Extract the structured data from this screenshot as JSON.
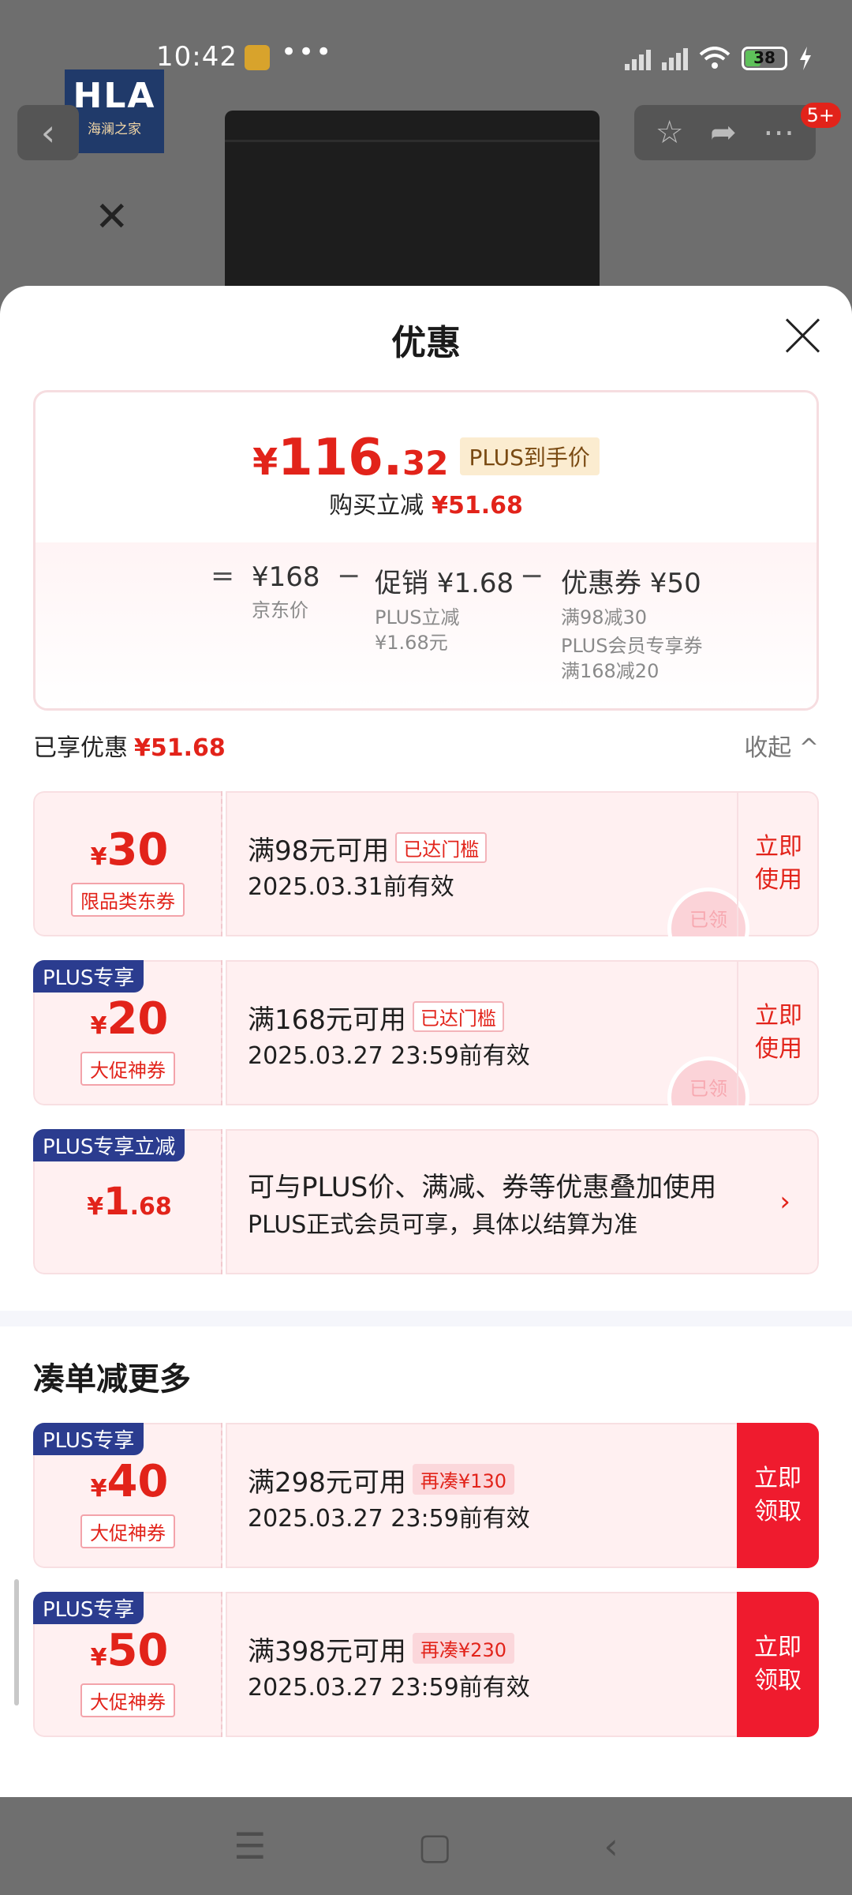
{
  "status_bar": {
    "time": "10:42",
    "dots": "•••",
    "battery": "38"
  },
  "background": {
    "logo_text": "HLA",
    "logo_sub": "海澜之家",
    "badge": "5+"
  },
  "sheet": {
    "title": "优惠",
    "final_price": {
      "yen": "¥",
      "int": "116.",
      "dec": "32"
    },
    "plus_tag": "PLUS到手价",
    "reduce_label": "购买立减",
    "reduce_value": "¥51.68",
    "formula": {
      "eq": "=",
      "minus": "−",
      "jd_price": "¥168",
      "jd_price_label": "京东价",
      "promo": "促销 ¥1.68",
      "promo_sub1": "PLUS立减",
      "promo_sub2": "¥1.68元",
      "coupon": "优惠券 ¥50",
      "coupon_sub1": "满98减30",
      "coupon_sub2": "PLUS会员专享券",
      "coupon_sub3": "满168减20"
    },
    "enjoyed_label": "已享优惠",
    "enjoyed_value": "¥51.68",
    "collapse_label": "收起 ^"
  },
  "coupons": [
    {
      "yen": "¥",
      "amount": "30",
      "tag": "限品类东券",
      "condition": "满98元可用",
      "status": "已达门槛",
      "validity": "2025.03.31前有效",
      "action": "立即\n使用",
      "stamp": "已领"
    },
    {
      "plus_label": "PLUS专享",
      "yen": "¥",
      "amount": "20",
      "tag": "大促神券",
      "condition": "满168元可用",
      "status": "已达门槛",
      "validity": "2025.03.27 23:59前有效",
      "action": "立即\n使用",
      "stamp": "已领"
    },
    {
      "plus_label": "PLUS专享立减",
      "yen": "¥",
      "amount": "1",
      "dec": ".68",
      "desc1": "可与PLUS价、满减、券等优惠叠加使用",
      "desc2": "PLUS正式会员可享，具体以结算为准",
      "chevron": "›"
    }
  ],
  "more_section": {
    "title": "凑单减更多",
    "coupons": [
      {
        "plus_label": "PLUS专享",
        "yen": "¥",
        "amount": "40",
        "tag": "大促神券",
        "condition": "满298元可用",
        "status": "再凑¥130",
        "validity": "2025.03.27 23:59前有效",
        "action": "立即\n领取"
      },
      {
        "plus_label": "PLUS专享",
        "yen": "¥",
        "amount": "50",
        "tag": "大促神券",
        "condition": "满398元可用",
        "status": "再凑¥230",
        "validity": "2025.03.27 23:59前有效",
        "action": "立即\n领取"
      }
    ]
  },
  "nav": {
    "menu": "☰",
    "home": "▢",
    "back": "‹"
  }
}
